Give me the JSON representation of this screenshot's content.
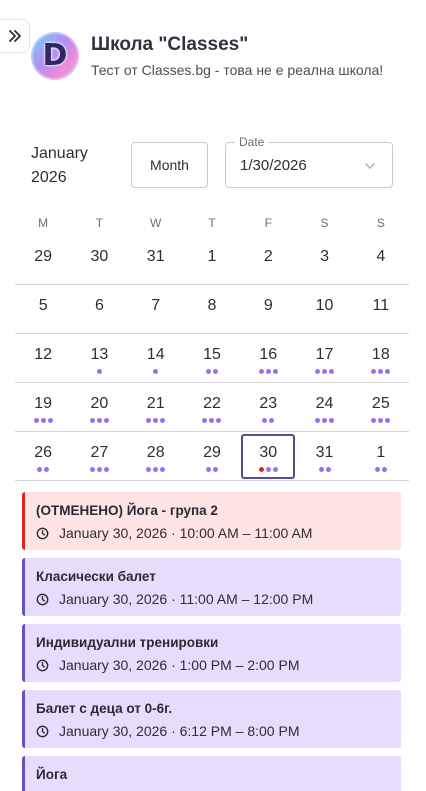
{
  "sidebar_toggle_icon": "double-chevron-right-icon",
  "school": {
    "logo_letter": "D",
    "name": "Школа \"Classes\"",
    "description": "Тест от Classes.bg - това не е реална школа!"
  },
  "controls": {
    "month_label": "January 2026",
    "view_button": "Month",
    "date_legend": "Date",
    "date_value": "1/30/2026"
  },
  "calendar": {
    "weekdays": [
      "M",
      "T",
      "W",
      "T",
      "F",
      "S",
      "S"
    ],
    "weeks": [
      [
        {
          "n": "29",
          "d": 0
        },
        {
          "n": "30",
          "d": 0
        },
        {
          "n": "31",
          "d": 0
        },
        {
          "n": "1",
          "d": 0
        },
        {
          "n": "2",
          "d": 0
        },
        {
          "n": "3",
          "d": 0
        },
        {
          "n": "4",
          "d": 0
        }
      ],
      [
        {
          "n": "5",
          "d": 0
        },
        {
          "n": "6",
          "d": 0
        },
        {
          "n": "7",
          "d": 0
        },
        {
          "n": "8",
          "d": 0
        },
        {
          "n": "9",
          "d": 0
        },
        {
          "n": "10",
          "d": 0
        },
        {
          "n": "11",
          "d": 0
        }
      ],
      [
        {
          "n": "12",
          "d": 0
        },
        {
          "n": "13",
          "d": 1
        },
        {
          "n": "14",
          "d": 1
        },
        {
          "n": "15",
          "d": 2
        },
        {
          "n": "16",
          "d": 3
        },
        {
          "n": "17",
          "d": 3
        },
        {
          "n": "18",
          "d": 3
        }
      ],
      [
        {
          "n": "19",
          "d": 3
        },
        {
          "n": "20",
          "d": 3
        },
        {
          "n": "21",
          "d": 3
        },
        {
          "n": "22",
          "d": 3
        },
        {
          "n": "23",
          "d": 2
        },
        {
          "n": "24",
          "d": 3
        },
        {
          "n": "25",
          "d": 3
        }
      ],
      [
        {
          "n": "26",
          "d": 2
        },
        {
          "n": "27",
          "d": 3
        },
        {
          "n": "28",
          "d": 3
        },
        {
          "n": "29",
          "d": 2
        },
        {
          "n": "30",
          "d": 3,
          "selected": true,
          "red": 1
        },
        {
          "n": "31",
          "d": 2
        },
        {
          "n": "1",
          "d": 2
        }
      ]
    ]
  },
  "colors": {
    "dot": "#9b6ff0",
    "cancelled_dot": "#e52222",
    "selected_border": "#5b4a91"
  },
  "events": [
    {
      "title": "(ОТМЕНЕНО) Йога - група 2",
      "time": "January 30, 2026 · 10:00 AM – 11:00 AM",
      "cancelled": true
    },
    {
      "title": "Класически балет",
      "time": "January 30, 2026 · 11:00 AM – 12:00 PM"
    },
    {
      "title": "Индивидуални тренировки",
      "time": "January 30, 2026 · 1:00 PM – 2:00 PM"
    },
    {
      "title": "Балет с деца от 0-6г.",
      "time": "January 30, 2026 · 6:12 PM – 8:00 PM"
    },
    {
      "title": "Йога",
      "time": ""
    }
  ]
}
